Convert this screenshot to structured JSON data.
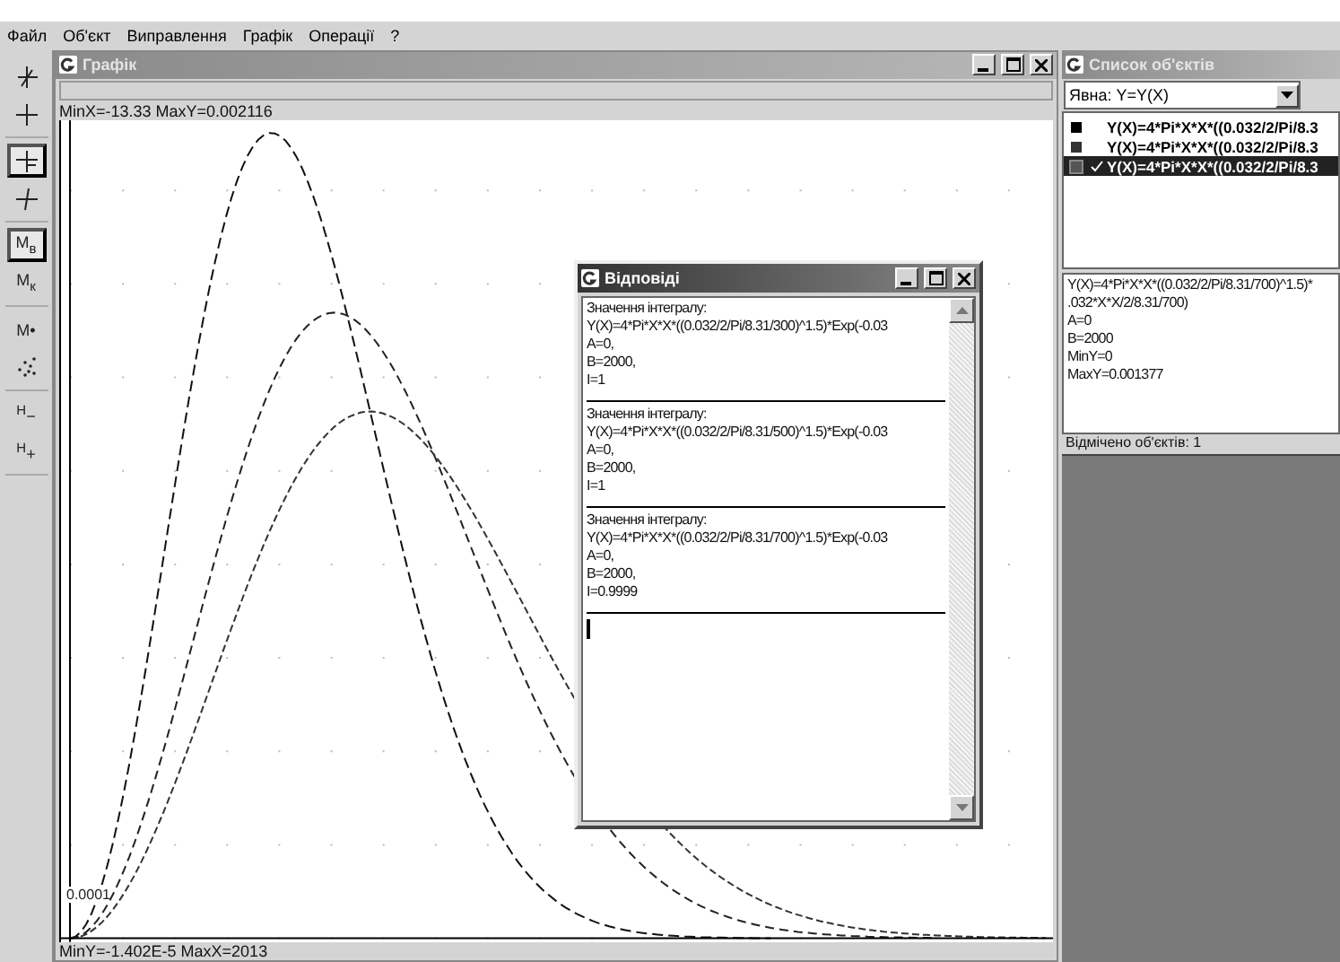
{
  "menu": [
    "Файл",
    "Об'єкт",
    "Виправлення",
    "Графік",
    "Операції",
    "?"
  ],
  "toolbar": [
    [
      {
        "kind": "axes",
        "selected": false
      },
      {
        "kind": "cross",
        "selected": false
      }
    ],
    [
      {
        "kind": "cross-bar",
        "selected": true
      },
      {
        "kind": "cross-tilt",
        "selected": false
      }
    ],
    [
      {
        "kind": "text",
        "label": "M$_{в}$",
        "selected": true
      },
      {
        "kind": "text",
        "label": "M$_{к}$",
        "selected": false
      }
    ],
    [
      {
        "kind": "text",
        "label": "M•",
        "selected": false
      },
      {
        "kind": "scatter",
        "selected": false
      }
    ],
    [
      {
        "kind": "text",
        "label": "$^{H}$−",
        "selected": false
      },
      {
        "kind": "text",
        "label": "$^{H}$+",
        "selected": false
      }
    ]
  ],
  "graph_window": {
    "title": "Графік",
    "top_info": "MinX=-13.33 MaxY=0.002116",
    "bottom_info": "MinY=-1.402E-5 MaxX=2013",
    "y_label": "0.0001"
  },
  "answers_window": {
    "title": "Відповіді",
    "entries": [
      {
        "heading": "Значення інтегралу:",
        "formula": "Y(X)=4*Pi*X*X*((0.032/2/Pi/8.31/300)^1.5)*Exp(-0.03",
        "lines": [
          "A=0,",
          "B=2000,",
          "I=1"
        ]
      },
      {
        "heading": "Значення інтегралу:",
        "formula": "Y(X)=4*Pi*X*X*((0.032/2/Pi/8.31/500)^1.5)*Exp(-0.03",
        "lines": [
          "A=0,",
          "B=2000,",
          "I=1"
        ]
      },
      {
        "heading": "Значення інтегралу:",
        "formula": "Y(X)=4*Pi*X*X*((0.032/2/Pi/8.31/700)^1.5)*Exp(-0.03",
        "lines": [
          "A=0,",
          "B=2000,",
          "I=0.9999"
        ]
      }
    ]
  },
  "objects_window": {
    "title": "Список об'єктів",
    "filter": "Явна: Y=Y(X)",
    "items": [
      {
        "text": "Y(X)=4*Pi*X*X*((0.032/2/Pi/8.3",
        "color": "#000000",
        "checked": false,
        "selected": false
      },
      {
        "text": "Y(X)=4*Pi*X*X*((0.032/2/Pi/8.3",
        "color": "#333333",
        "checked": false,
        "selected": false
      },
      {
        "text": "Y(X)=4*Pi*X*X*((0.032/2/Pi/8.3",
        "color": "#555555",
        "checked": true,
        "selected": true
      }
    ],
    "details": [
      "Y(X)=4*Pi*X*X*((0.032/2/Pi/8.31/700)^1.5)*",
      ".032*X*X/2/8.31/700)",
      "A=0",
      "B=2000",
      "MinY=0",
      "MaxY=0.001377"
    ],
    "status": "Відмічено об'єктів: 1"
  }
}
